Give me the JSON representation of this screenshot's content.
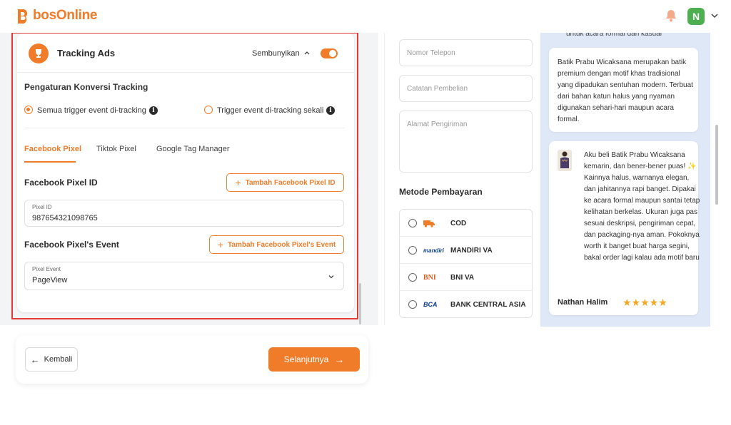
{
  "app": {
    "logo_text": "bosOnline",
    "avatar_letter": "N"
  },
  "tracking": {
    "title": "Tracking Ads",
    "hide_label": "Sembunyikan",
    "toggle_on": true,
    "conversion_title": "Pengaturan Konversi Tracking",
    "options": [
      {
        "label": "Semua trigger event di-tracking",
        "selected": true
      },
      {
        "label": "Trigger event di-tracking sekali",
        "selected": false
      }
    ],
    "tabs": [
      "Facebook Pixel",
      "Tiktok Pixel",
      "Google Tag Manager"
    ],
    "active_tab": "Facebook Pixel",
    "pixel_id_title": "Facebook Pixel ID",
    "add_pixel_id_label": "Tambah Facebook Pixel ID",
    "pixel_id_field_label": "Pixel ID",
    "pixel_id_value": "987654321098765",
    "pixel_event_title": "Facebook Pixel's Event",
    "add_pixel_event_label": "Tambah Facebook Pixel's Event",
    "pixel_event_field_label": "Pixel Event",
    "pixel_event_value": "PageView"
  },
  "nav": {
    "back_label": "Kembali",
    "next_label": "Selanjutnya"
  },
  "preview": {
    "phone_placeholder": "Nomor Telepon",
    "note_placeholder": "Catatan Pembelian",
    "address_placeholder": "Alamat Pengiriman",
    "payment_title": "Metode Pembayaran",
    "payments": [
      {
        "name": "COD",
        "logo": "truck-icon"
      },
      {
        "name": "MANDIRI VA",
        "logo": "mandiri"
      },
      {
        "name": "BNI VA",
        "logo": "BNI"
      },
      {
        "name": "BANK CENTRAL ASIA",
        "logo": "BCA"
      }
    ]
  },
  "review": {
    "top_text": "untuk acara formal dan kasual",
    "description": "Batik Prabu Wicaksana merupakan batik premium dengan motif khas tradisional yang dipadukan sentuhan modern. Terbuat dari bahan katun halus yang nyaman digunakan sehari-hari maupun acara formal.",
    "testimonial": "Aku beli Batik Prabu Wicaksana kemarin, dan bener-bener puas! ✨ Kainnya halus, warnanya elegan, dan jahitannya rapi banget. Dipakai ke acara formal maupun santai tetap kelihatan berkelas. Ukuran juga pas sesuai deskripsi, pengiriman cepat, dan packaging-nya aman. Pokoknya worth it banget buat harga segini, bakal order lagi kalau ada motif baru",
    "reviewer": "Nathan Halim",
    "rating": 5,
    "star_glyph": "★★★★★"
  },
  "colors": {
    "accent": "#f07c2a",
    "highlight": "#e53935",
    "review_bg": "#dfe8f7"
  }
}
